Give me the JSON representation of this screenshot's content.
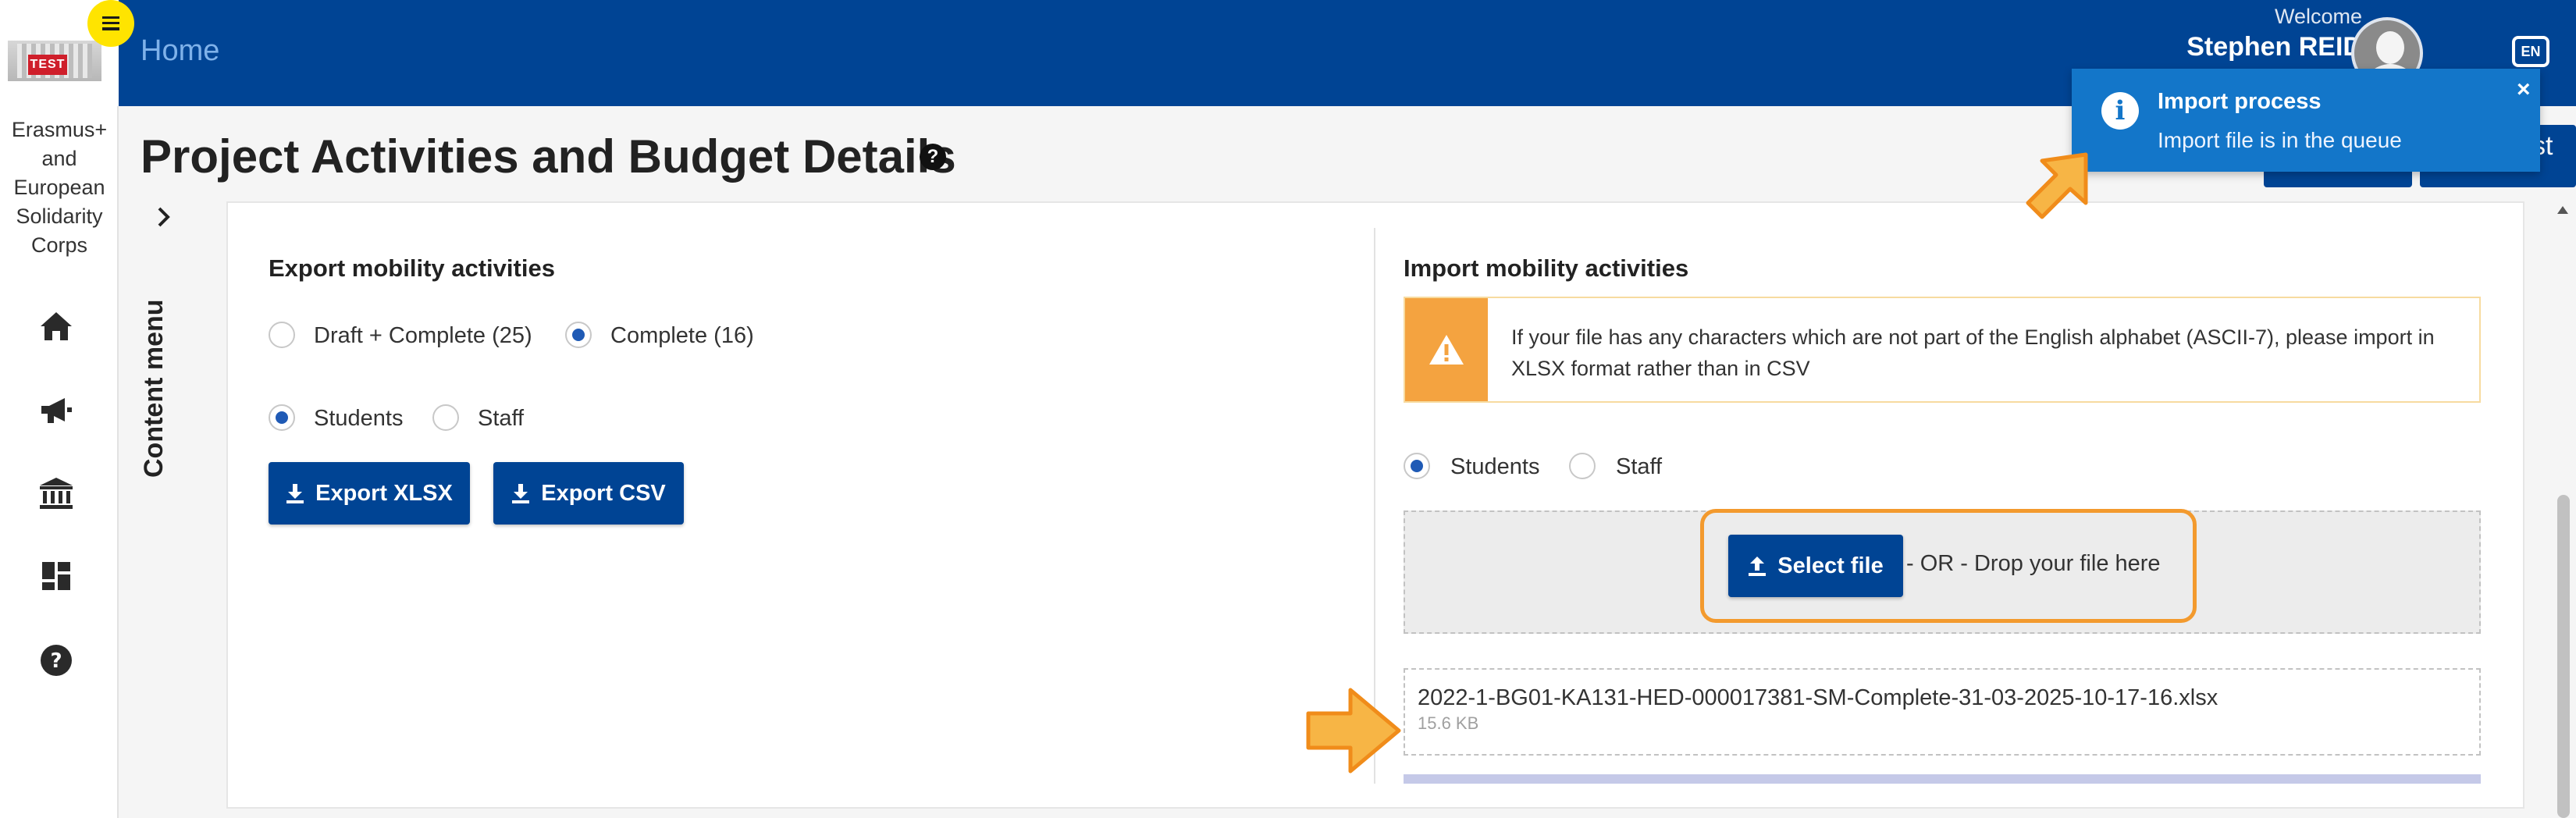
{
  "header": {
    "home_label": "Home",
    "welcome_label": "Welcome",
    "user_name": "Stephen REID",
    "language_code": "EN",
    "partial_button_text": "st"
  },
  "sidebar": {
    "logo_text": "TEST",
    "program_name": "Erasmus+ and European Solidarity Corps",
    "nav_items": [
      {
        "icon": "home-icon"
      },
      {
        "icon": "megaphone-icon"
      },
      {
        "icon": "institution-icon"
      },
      {
        "icon": "dashboard-icon"
      },
      {
        "icon": "help-icon"
      }
    ]
  },
  "page": {
    "title": "Project Activities and Budget Details",
    "content_menu_label": "Content menu"
  },
  "export": {
    "title": "Export mobility activities",
    "status_options": [
      {
        "label": "Draft + Complete (25)",
        "checked": false
      },
      {
        "label": "Complete (16)",
        "checked": true
      }
    ],
    "participant_options": [
      {
        "label": "Students",
        "checked": true
      },
      {
        "label": "Staff",
        "checked": false
      }
    ],
    "xlsx_button": "Export XLSX",
    "csv_button": "Export CSV"
  },
  "import": {
    "title": "Import mobility activities",
    "warning_text": "If your file has any characters which are not part of the English alphabet (ASCII-7), please import in XLSX format rather than in CSV",
    "participant_options": [
      {
        "label": "Students",
        "checked": true
      },
      {
        "label": "Staff",
        "checked": false
      }
    ],
    "select_file_button": "Select file",
    "drop_text": "- OR - Drop your file here",
    "file": {
      "name": "2022-1-BG01-KA131-HED-000017381-SM-Complete-31-03-2025-10-17-16.xlsx",
      "size": "15.6 KB"
    }
  },
  "toast": {
    "title": "Import process",
    "message": "Import file is in the queue",
    "close_symbol": "×"
  },
  "colors": {
    "header_blue": "#004494",
    "toast_blue": "#1376c9",
    "highlight_orange": "#f39a2e",
    "warning_orange": "#f4a340",
    "menu_yellow": "#ffe400"
  }
}
